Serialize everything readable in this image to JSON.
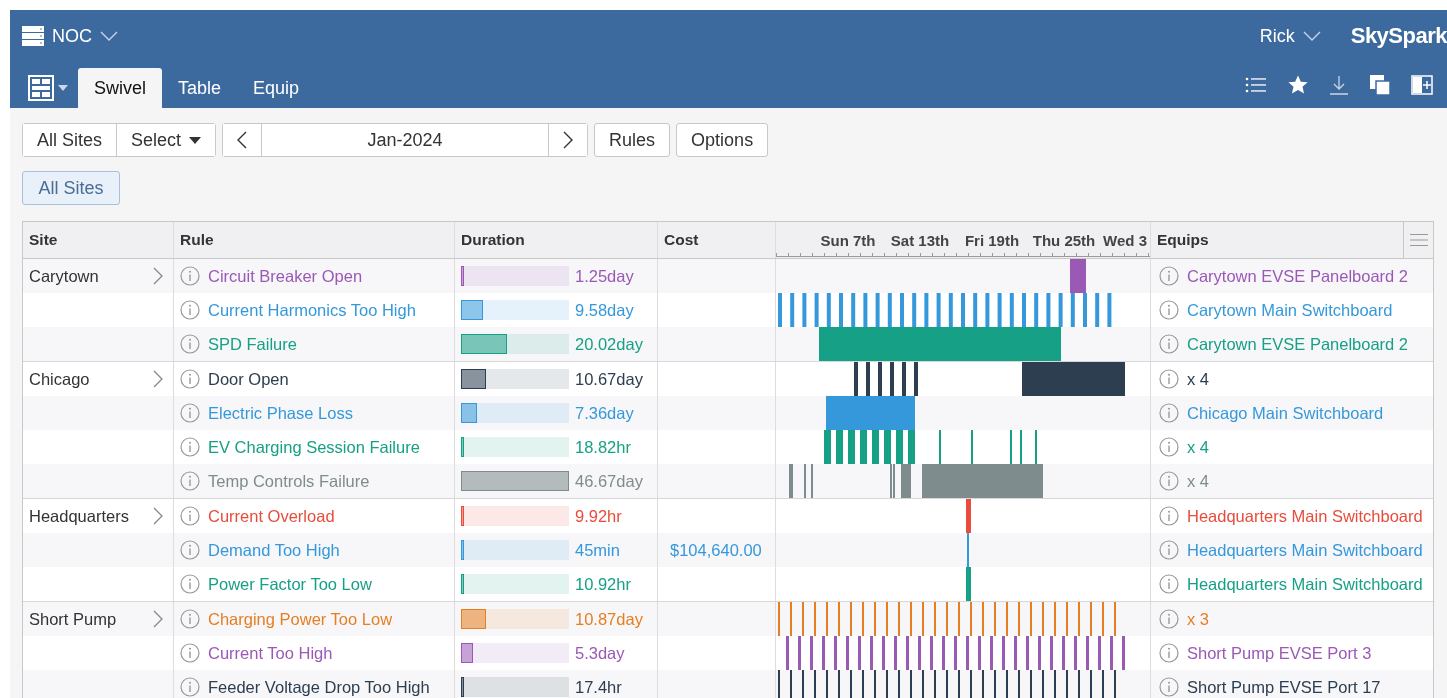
{
  "header": {
    "project": "NOC",
    "user": "Rick",
    "brand": "SkySpark"
  },
  "tabs": [
    {
      "label": "Swivel",
      "selected": true
    },
    {
      "label": "Table",
      "selected": false
    },
    {
      "label": "Equip",
      "selected": false
    }
  ],
  "toolbar": {
    "sites_button": "All Sites",
    "select_button": "Select",
    "period": "Jan-2024",
    "rules_button": "Rules",
    "options_button": "Options",
    "filter_chip": "All Sites"
  },
  "table": {
    "columns": [
      "Site",
      "Rule",
      "Duration",
      "Cost",
      "Equips"
    ],
    "timeline_labels": [
      "Sun 7th",
      "Sat 13th",
      "Fri 19th",
      "Thu 25th",
      "Wed 3"
    ],
    "groups": [
      {
        "site": "Carytown",
        "rows": [
          {
            "rule": "Circuit Breaker Open",
            "color": "#9b59b6",
            "level": 0.02,
            "duration": "1.25day",
            "equip": "Carytown EVSE Panelboard 2"
          },
          {
            "rule": "Current Harmonics Too High",
            "color": "#3498db",
            "level": 0.2,
            "duration": "9.58day",
            "equip": "Carytown Main Switchboard"
          },
          {
            "rule": "SPD Failure",
            "color": "#16a085",
            "level": 0.43,
            "duration": "20.02day",
            "equip": "Carytown EVSE Panelboard 2"
          }
        ]
      },
      {
        "site": "Chicago",
        "rows": [
          {
            "rule": "Door Open",
            "color": "#2c3e50",
            "level": 0.23,
            "duration": "10.67day",
            "equip": "x 4"
          },
          {
            "rule": "Electric Phase Loss",
            "color": "#3498db",
            "level": 0.15,
            "duration": "7.36day",
            "equip": "Chicago Main Switchboard"
          },
          {
            "rule": "EV Charging Session Failure",
            "color": "#16a085",
            "level": 0.02,
            "duration": "18.82hr",
            "equip": "x 4"
          },
          {
            "rule": "Temp Controls Failure",
            "color": "#7f8c8d",
            "level": 1,
            "duration": "46.67day",
            "equip": "x 4"
          }
        ]
      },
      {
        "site": "Headquarters",
        "rows": [
          {
            "rule": "Current Overload",
            "color": "#e74c3c",
            "level": 0.02,
            "duration": "9.92hr",
            "equip": "Headquarters Main Switchboard"
          },
          {
            "rule": "Demand Too High",
            "color": "#3498db",
            "level": 0.01,
            "duration": "45min",
            "cost": "$104,640.00",
            "equip": "Headquarters Main Switchboard"
          },
          {
            "rule": "Power Factor Too Low",
            "color": "#16a085",
            "level": 0.02,
            "duration": "10.92hr",
            "equip": "Headquarters Main Switchboard"
          }
        ]
      },
      {
        "site": "Short Pump",
        "rows": [
          {
            "rule": "Charging Power Too Low",
            "color": "#e67e22",
            "level": 0.23,
            "duration": "10.87day",
            "equip": "x 3"
          },
          {
            "rule": "Current Too High",
            "color": "#9b59b6",
            "level": 0.11,
            "duration": "5.3day",
            "equip": "Short Pump EVSE Port 3"
          },
          {
            "rule": "Feeder Voltage Drop Too High",
            "color": "#2c3e50",
            "level": 0.02,
            "duration": "17.4hr",
            "equip": "Short Pump EVSE Port 17"
          }
        ]
      }
    ]
  }
}
